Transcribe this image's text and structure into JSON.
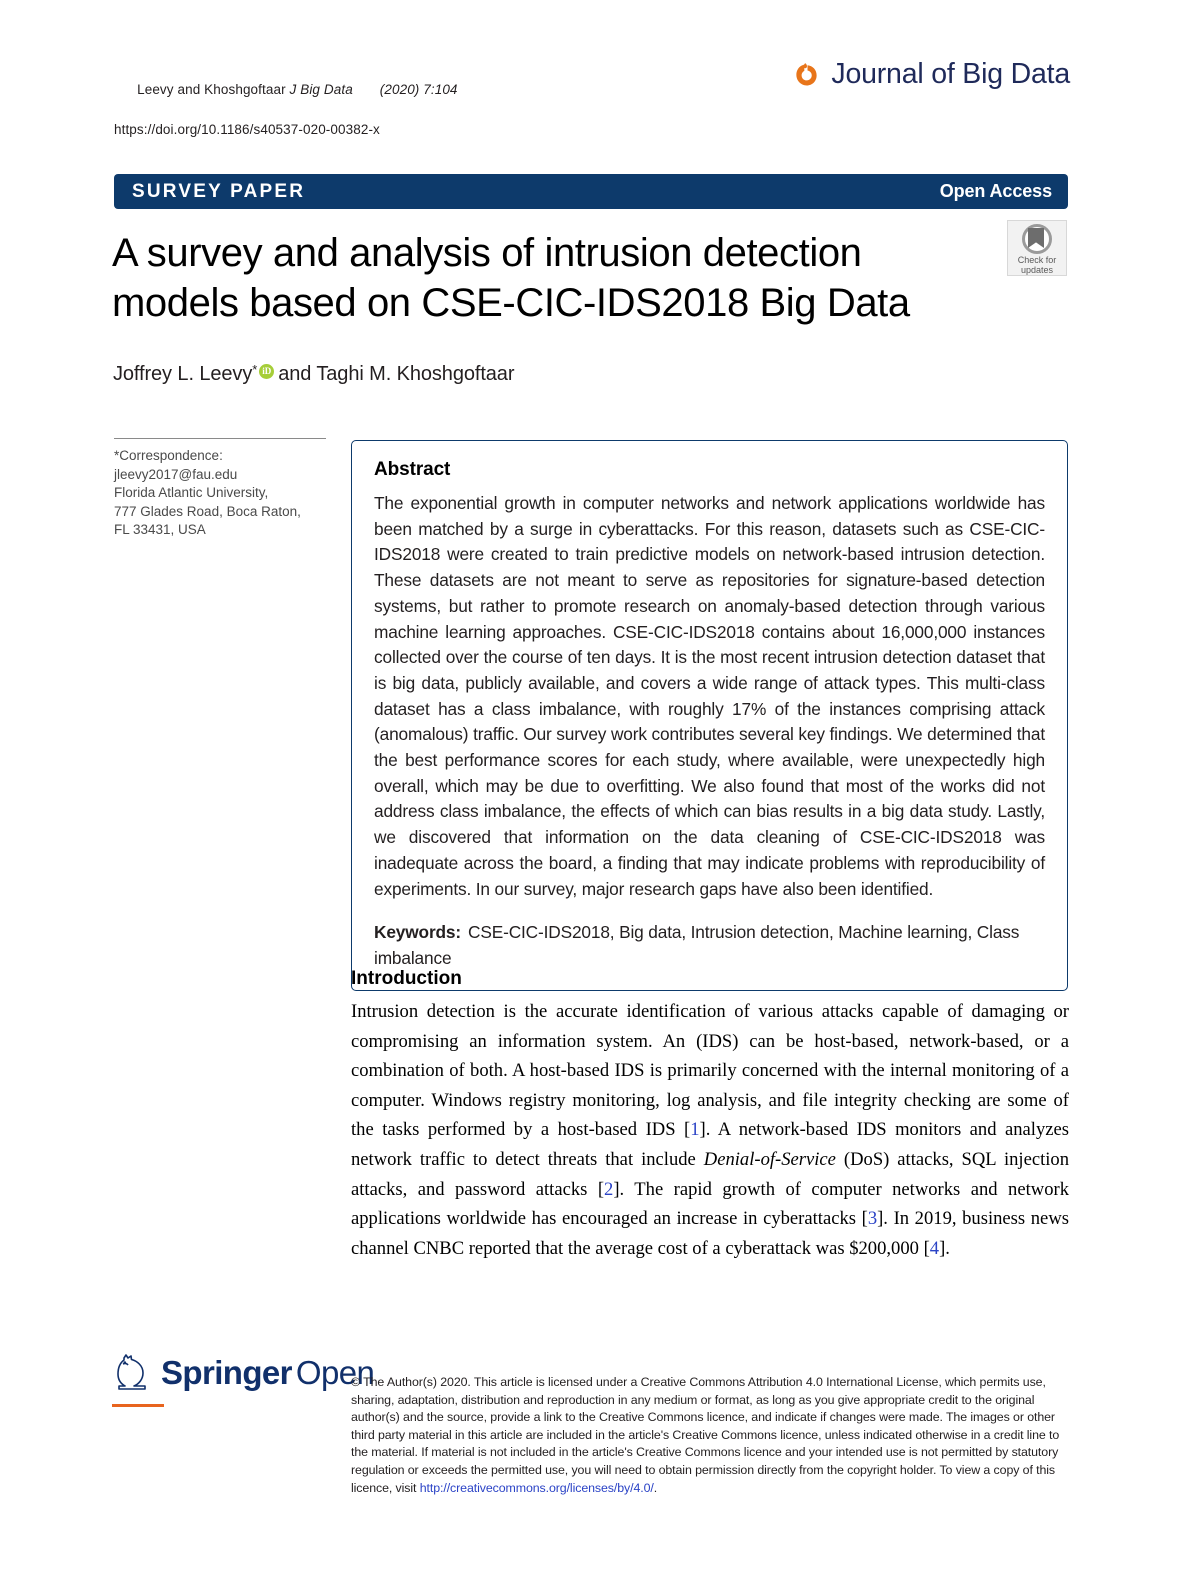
{
  "running_head": {
    "authors_journal": "Leevy and Khoshgoftaar ",
    "journal_italic": "J Big Data",
    "volume_italic": "(2020) 7:104",
    "doi": "https://doi.org/10.1186/s40537-020-00382-x"
  },
  "brand": {
    "mark_icon": "journal-of-big-data-logo-icon",
    "title": "Journal of Big Data",
    "mark_color": "#e8751a",
    "title_color": "#1f2a5a"
  },
  "access_bar": {
    "paper_type": "SURVEY PAPER",
    "access_label": "Open Access",
    "background_color": "#0d3a6b"
  },
  "article": {
    "title": "A survey and analysis of intrusion detection models based on CSE-CIC-IDS2018 Big Data",
    "authors_prefix": "Joffrey L. Leevy",
    "corresponding_marker": "*",
    "orcid_icon": "orcid-id-icon",
    "authors_suffix": "and Taghi M. Khoshgoftaar"
  },
  "crossmark": {
    "icon": "crossmark-check-for-updates-icon",
    "line1": "Check for",
    "line2": "updates"
  },
  "correspondence": {
    "label": "*Correspondence:",
    "email": "jleevy2017@fau.edu",
    "affiliation_line1": "Florida Atlantic University,",
    "affiliation_line2": "777 Glades Road, Boca Raton,",
    "affiliation_line3": "FL 33431, USA"
  },
  "abstract": {
    "heading": "Abstract",
    "body": "The exponential growth in computer networks and network applications worldwide has been matched by a surge in cyberattacks. For this reason, datasets such as CSE-CIC-IDS2018 were created to train predictive models on network-based intrusion detection. These datasets are not meant to serve as repositories for signature-based detection systems, but rather to promote research on anomaly-based detection through various machine learning approaches. CSE-CIC-IDS2018 contains about 16,000,000 instances collected over the course of ten days. It is the most recent intrusion detection dataset that is big data, publicly available, and covers a wide range of attack types. This multi-class dataset has a class imbalance, with roughly 17% of the instances comprising attack (anomalous) traffic. Our survey work contributes several key findings. We determined that the best performance scores for each study, where available, were unexpectedly high overall, which may be due to overfitting. We also found that most of the works did not address class imbalance, the effects of which can bias results in a big data study. Lastly, we discovered that information on the data cleaning of CSE-CIC-IDS2018 was inadequate across the board, a finding that may indicate problems with reproducibility of experiments. In our survey, major research gaps have also been identified.",
    "keywords_label": "Keywords:",
    "keywords": "CSE-CIC-IDS2018, Big data, Intrusion detection, Machine learning, Class imbalance",
    "border_color": "#0d3a6b"
  },
  "introduction": {
    "heading": "Introduction",
    "paragraph_parts": {
      "p1": "Intrusion detection is the accurate identification of various attacks capable of damaging or compromising an information system. An (IDS) can be host-based, network-based, or a combination of both. A host-based IDS is primarily concerned with the internal monitoring of a computer. Windows registry monitoring, log analysis, and file integrity checking are some of the tasks performed by a host-based IDS [",
      "ref1": "1",
      "p2": "]. A network-based IDS monitors and analyzes network traffic to detect threats that include ",
      "italic1": "Denial-of-Service",
      "p3": " (DoS) attacks, SQL injection attacks, and password attacks [",
      "ref2": "2",
      "p4": "]. The rapid growth of computer networks and network applications worldwide has encouraged an increase in cyberattacks [",
      "ref3": "3",
      "p5": "]. In 2019, business news channel CNBC reported that the average cost of a cyberattack was $200,000 [",
      "ref4": "4",
      "p6": "]."
    },
    "link_color": "#2b43c6"
  },
  "footer": {
    "publisher_icon": "springer-horse-logo-icon",
    "publisher_bold": "Springer",
    "publisher_light": "Open",
    "publisher_color": "#11306b",
    "accent_rule_color": "#e8641e",
    "license_text_part1": "© The Author(s) 2020. This article is licensed under a Creative Commons Attribution 4.0 International License, which permits use, sharing, adaptation, distribution and reproduction in any medium or format, as long as you give appropriate credit to the original author(s) and the source, provide a link to the Creative Commons licence, and indicate if changes were made. The images or other third party material in this article are included in the article's Creative Commons licence, unless indicated otherwise in a credit line to the material. If material is not included in the article's Creative Commons licence and your intended use is not permitted by statutory regulation or exceeds the permitted use, you will need to obtain permission directly from the copyright holder. To view a copy of this licence, visit ",
    "license_url": "http://creativecommons.org/licenses/by/4.0/",
    "license_text_part2": "."
  }
}
